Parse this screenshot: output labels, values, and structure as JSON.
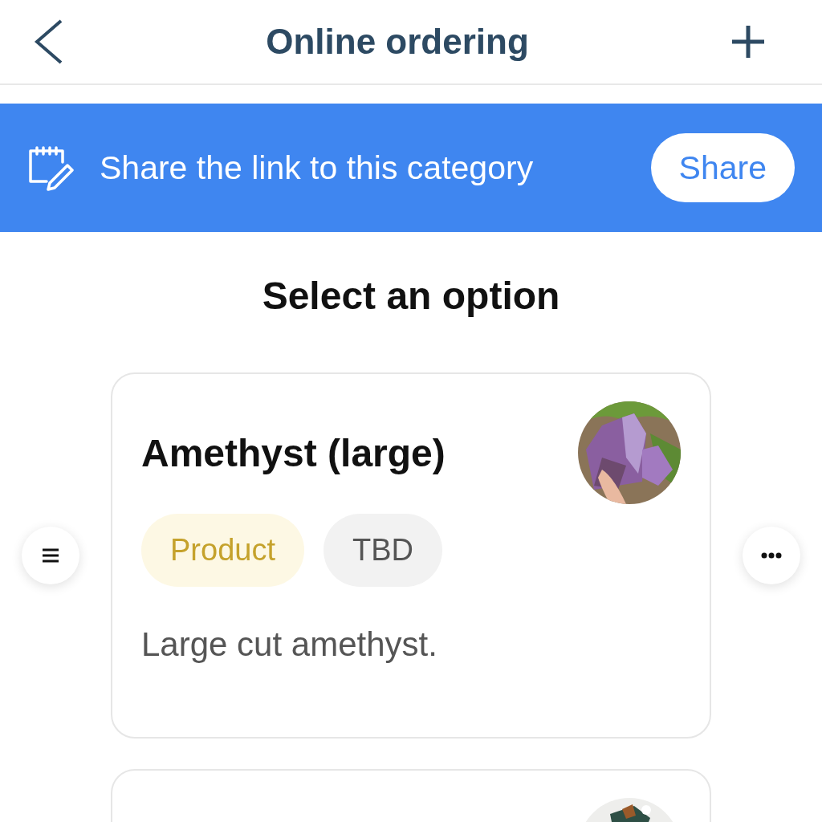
{
  "header": {
    "title": "Online ordering"
  },
  "banner": {
    "text": "Share the link to this category",
    "button": "Share"
  },
  "heading": "Select an option",
  "cards": [
    {
      "title": "Amethyst (large)",
      "image": {
        "kind": "picture"
      },
      "tags": [
        {
          "label": "Product",
          "kind": "type"
        },
        {
          "label": "TBD",
          "kind": "status"
        }
      ],
      "description": "Large cut amethyst."
    },
    {
      "image": {
        "kind": "picture"
      }
    }
  ]
}
